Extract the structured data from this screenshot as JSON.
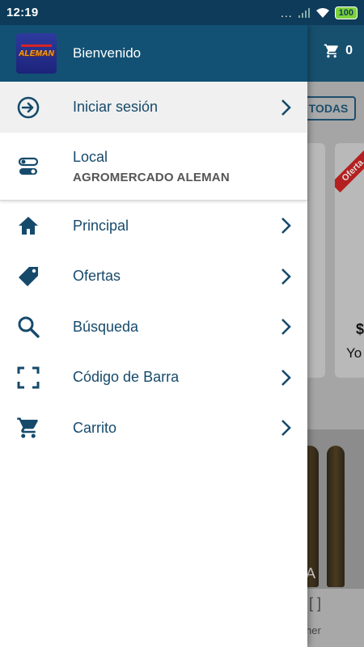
{
  "status_bar": {
    "time": "12:19",
    "battery": "100",
    "dots": "..."
  },
  "background": {
    "cart_count": "0",
    "filter_button": "TODAS",
    "offer_badge": "Oferta",
    "price_fragment": "$",
    "name_fragment": "Yo",
    "bottle_text": "A",
    "bottom_label": "ner"
  },
  "drawer": {
    "header_title": "Bienvenido",
    "logo_text": "ALEMAN",
    "login": {
      "label": "Iniciar sesión",
      "icon": "login-icon"
    },
    "local": {
      "label": "Local",
      "value": "AGROMERCADO ALEMAN",
      "icon": "toggle-icon"
    },
    "items": [
      {
        "label": "Principal",
        "icon": "home-icon"
      },
      {
        "label": "Ofertas",
        "icon": "tag-icon"
      },
      {
        "label": "Búsqueda",
        "icon": "search-icon"
      },
      {
        "label": "Código de Barra",
        "icon": "barcode-scan-icon"
      },
      {
        "label": "Carrito",
        "icon": "cart-icon"
      }
    ]
  },
  "colors": {
    "primary": "#125174",
    "text": "#164a6b",
    "status_bar": "#0d3b59",
    "offer": "#b51f1f"
  }
}
